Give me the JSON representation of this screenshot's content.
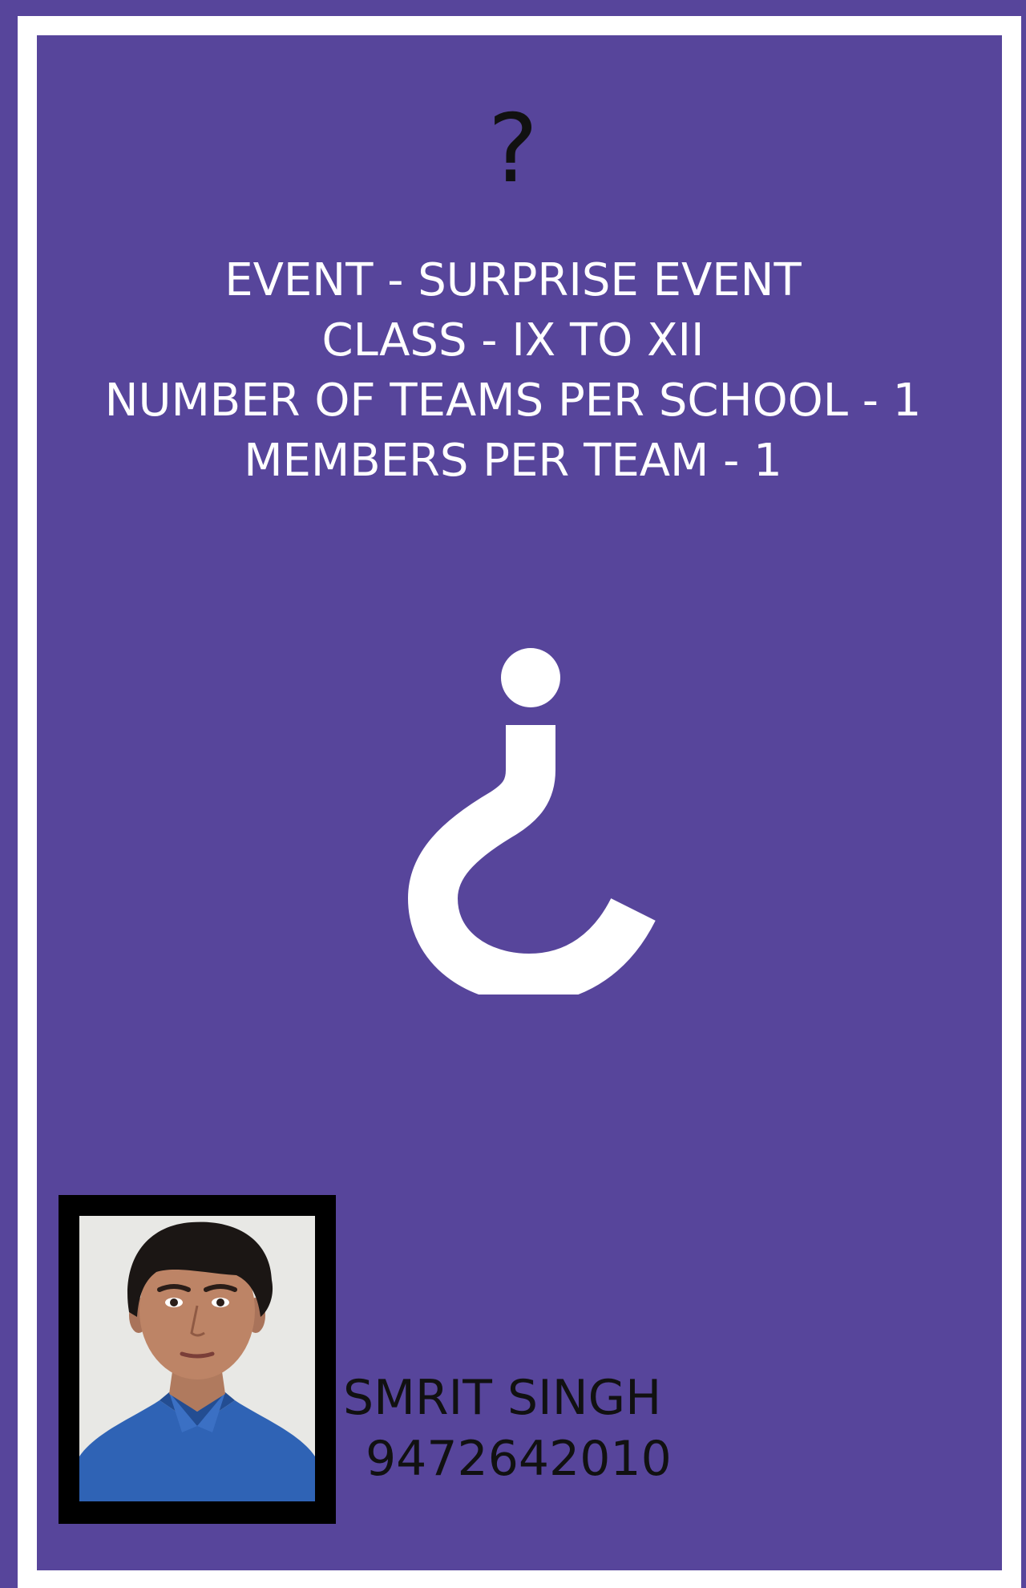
{
  "poster": {
    "background_color": "#57459b",
    "frame_color": "#ffffff",
    "top_symbol": "?",
    "details": [
      "EVENT - SURPRISE EVENT",
      "CLASS - IX TO XII",
      "NUMBER OF TEAMS PER SCHOOL - 1",
      "MEMBERS PER TEAM - 1"
    ],
    "center_icon": "inverted-question-mark-icon",
    "contact": {
      "name": "SMRIT SINGH",
      "phone": "9472642010"
    }
  }
}
